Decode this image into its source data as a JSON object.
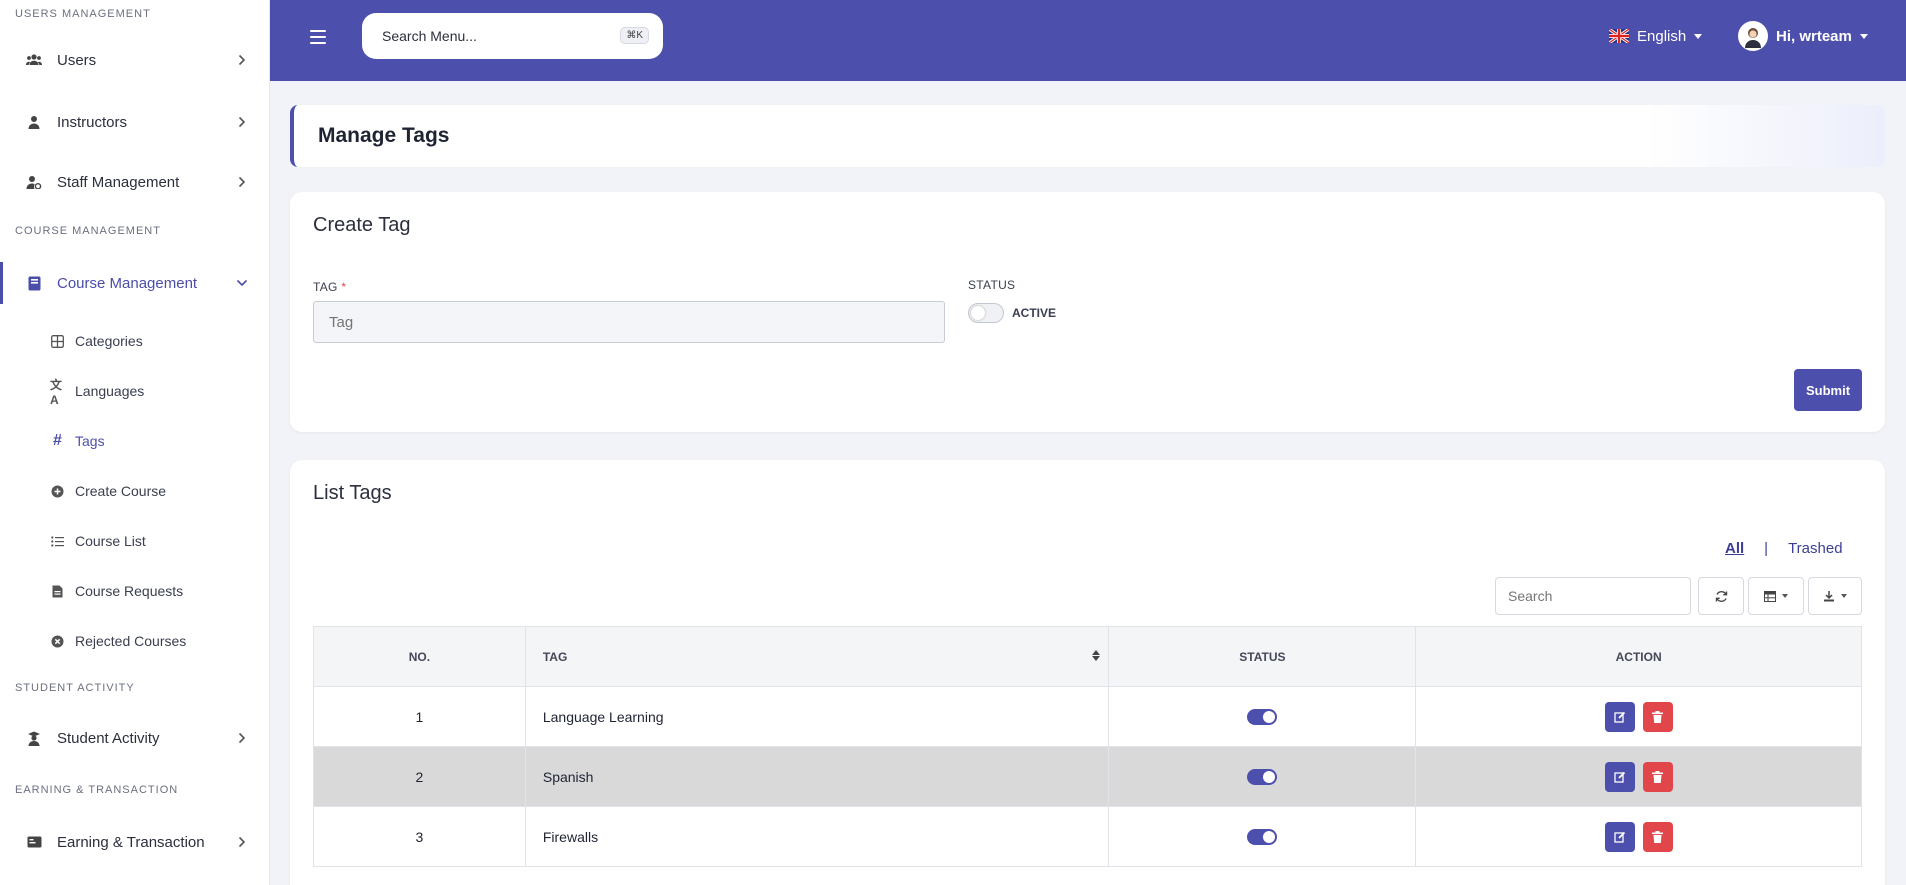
{
  "sidebar": {
    "sections": {
      "users_management": "USERS MANAGEMENT",
      "course_management": "COURSE MANAGEMENT",
      "student_activity": "STUDENT ACTIVITY",
      "earning_transaction": "EARNING & TRANSACTION"
    },
    "items": {
      "users": "Users",
      "instructors": "Instructors",
      "staff_management": "Staff Management",
      "course_management": "Course Management",
      "student_activity": "Student Activity",
      "earning_transaction": "Earning & Transaction"
    },
    "sub_items": {
      "categories": "Categories",
      "languages": "Languages",
      "tags": "Tags",
      "create_course": "Create Course",
      "course_list": "Course List",
      "course_requests": "Course Requests",
      "rejected_courses": "Rejected Courses"
    }
  },
  "header": {
    "search_placeholder": "Search Menu...",
    "shortcut": "⌘K",
    "language": "English",
    "user_greeting": "Hi, wrteam"
  },
  "page": {
    "title": "Manage Tags"
  },
  "create_form": {
    "title": "Create Tag",
    "tag_label": "TAG",
    "required_mark": "*",
    "tag_placeholder": "Tag",
    "status_label": "STATUS",
    "status_toggle_label": "ACTIVE",
    "status_active": false,
    "submit_label": "Submit"
  },
  "list": {
    "title": "List Tags",
    "filter_all": "All",
    "filter_sep": "|",
    "filter_trashed": "Trashed",
    "search_placeholder": "Search",
    "columns": {
      "no": "NO.",
      "tag": "TAG",
      "status": "STATUS",
      "action": "ACTION"
    },
    "rows": [
      {
        "no": "1",
        "tag": "Language Learning",
        "status": true
      },
      {
        "no": "2",
        "tag": "Spanish",
        "status": true
      },
      {
        "no": "3",
        "tag": "Firewalls",
        "status": true
      }
    ]
  },
  "colors": {
    "primary": "#4d4fad",
    "danger": "#e0464a",
    "row_highlight": "#d9d9d9"
  }
}
